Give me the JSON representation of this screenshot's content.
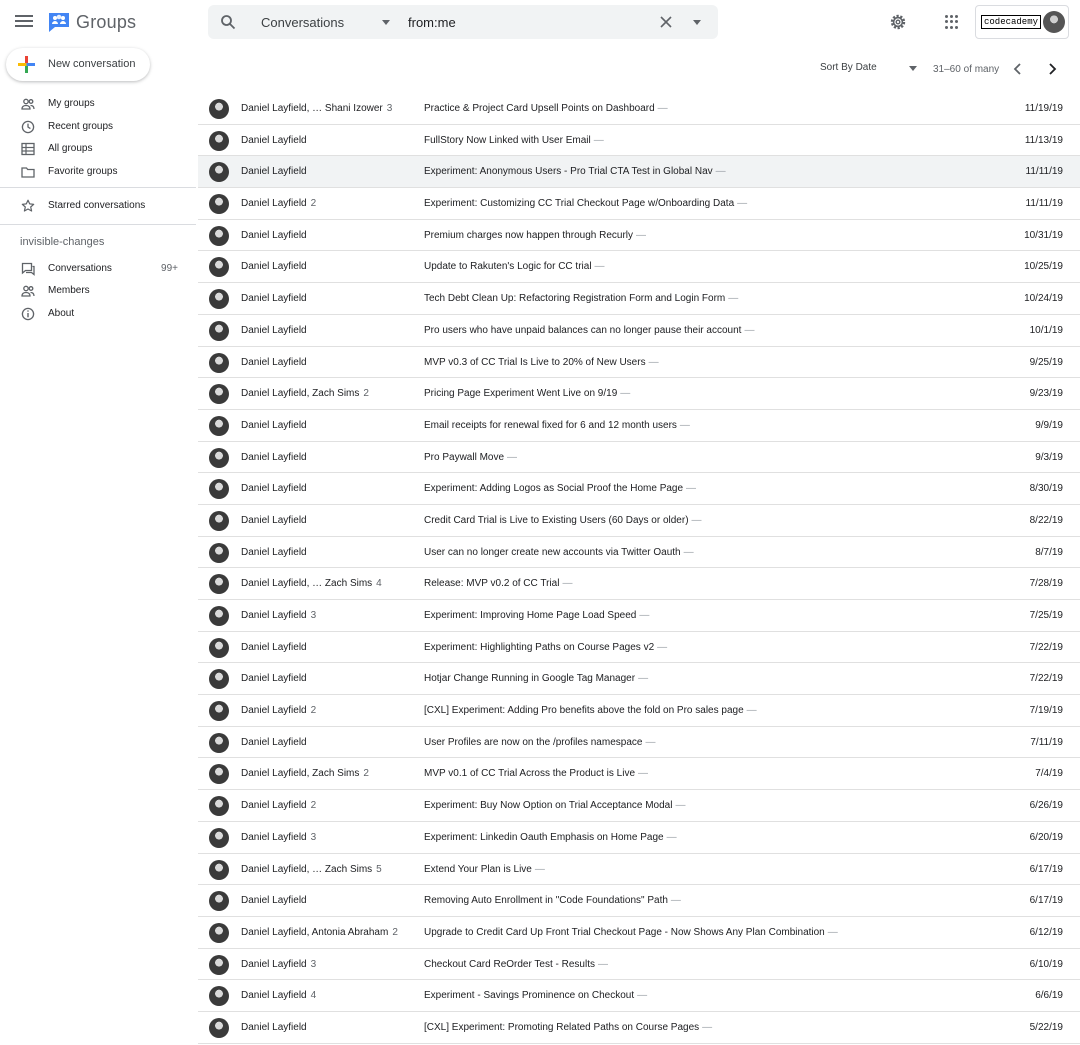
{
  "app": {
    "title": "Groups"
  },
  "search": {
    "scope": "Conversations",
    "query": "from:me"
  },
  "account": {
    "org_logo_text": "codecademy"
  },
  "sidebar": {
    "new_conversation": "New conversation",
    "items": [
      {
        "label": "My groups",
        "icon": "people-icon"
      },
      {
        "label": "Recent groups",
        "icon": "clock-icon"
      },
      {
        "label": "All groups",
        "icon": "table-icon"
      },
      {
        "label": "Favorite groups",
        "icon": "folder-icon"
      },
      {
        "label": "Starred conversations",
        "icon": "star-icon"
      }
    ],
    "section": "invisible-changes",
    "group_items": [
      {
        "label": "Conversations",
        "count": "99+",
        "icon": "chat-icon"
      },
      {
        "label": "Members",
        "icon": "people-icon"
      },
      {
        "label": "About",
        "icon": "info-icon"
      }
    ]
  },
  "toolbar": {
    "sort_label": "Sort By Date",
    "range": "31–60 of many"
  },
  "conversations": [
    {
      "author": "Daniel Layfield, … Shani Izower",
      "count": "3",
      "subject": "Practice & Project Card Upsell Points on Dashboard",
      "date": "11/19/19"
    },
    {
      "author": "Daniel Layfield",
      "count": "",
      "subject": "FullStory Now Linked with User Email",
      "date": "11/13/19"
    },
    {
      "author": "Daniel Layfield",
      "count": "",
      "subject": "Experiment: Anonymous Users - Pro Trial CTA Test in Global Nav",
      "date": "11/11/19"
    },
    {
      "author": "Daniel Layfield",
      "count": "2",
      "subject": "Experiment: Customizing CC Trial Checkout Page w/Onboarding Data",
      "date": "11/11/19"
    },
    {
      "author": "Daniel Layfield",
      "count": "",
      "subject": "Premium charges now happen through Recurly",
      "date": "10/31/19"
    },
    {
      "author": "Daniel Layfield",
      "count": "",
      "subject": "Update to Rakuten's Logic for CC trial",
      "date": "10/25/19"
    },
    {
      "author": "Daniel Layfield",
      "count": "",
      "subject": "Tech Debt Clean Up: Refactoring Registration Form and Login Form",
      "date": "10/24/19"
    },
    {
      "author": "Daniel Layfield",
      "count": "",
      "subject": "Pro users who have unpaid balances can no longer pause their account",
      "date": "10/1/19"
    },
    {
      "author": "Daniel Layfield",
      "count": "",
      "subject": "MVP v0.3 of CC Trial Is Live to 20% of New Users",
      "date": "9/25/19"
    },
    {
      "author": "Daniel Layfield, Zach Sims",
      "count": "2",
      "subject": "Pricing Page Experiment Went Live on 9/19",
      "date": "9/23/19"
    },
    {
      "author": "Daniel Layfield",
      "count": "",
      "subject": "Email receipts for renewal fixed for 6 and 12 month users",
      "date": "9/9/19"
    },
    {
      "author": "Daniel Layfield",
      "count": "",
      "subject": "Pro Paywall Move",
      "date": "9/3/19"
    },
    {
      "author": "Daniel Layfield",
      "count": "",
      "subject": "Experiment: Adding Logos as Social Proof the Home Page",
      "date": "8/30/19"
    },
    {
      "author": "Daniel Layfield",
      "count": "",
      "subject": "Credit Card Trial is Live to Existing Users (60 Days or older)",
      "date": "8/22/19"
    },
    {
      "author": "Daniel Layfield",
      "count": "",
      "subject": "User can no longer create new accounts via Twitter Oauth",
      "date": "8/7/19"
    },
    {
      "author": "Daniel Layfield, … Zach Sims",
      "count": "4",
      "subject": "Release: MVP v0.2 of CC Trial",
      "date": "7/28/19"
    },
    {
      "author": "Daniel Layfield",
      "count": "3",
      "subject": "Experiment: Improving Home Page Load Speed",
      "date": "7/25/19"
    },
    {
      "author": "Daniel Layfield",
      "count": "",
      "subject": "Experiment: Highlighting Paths on Course Pages v2",
      "date": "7/22/19"
    },
    {
      "author": "Daniel Layfield",
      "count": "",
      "subject": "Hotjar Change Running in Google Tag Manager",
      "date": "7/22/19"
    },
    {
      "author": "Daniel Layfield",
      "count": "2",
      "subject": "[CXL] Experiment: Adding Pro benefits above the fold on Pro sales page",
      "date": "7/19/19"
    },
    {
      "author": "Daniel Layfield",
      "count": "",
      "subject": "User Profiles are now on the /profiles namespace",
      "date": "7/11/19"
    },
    {
      "author": "Daniel Layfield, Zach Sims",
      "count": "2",
      "subject": "MVP v0.1 of CC Trial Across the Product is Live",
      "date": "7/4/19"
    },
    {
      "author": "Daniel Layfield",
      "count": "2",
      "subject": "Experiment: Buy Now Option on Trial Acceptance Modal",
      "date": "6/26/19"
    },
    {
      "author": "Daniel Layfield",
      "count": "3",
      "subject": "Experiment: Linkedin Oauth Emphasis on Home Page",
      "date": "6/20/19"
    },
    {
      "author": "Daniel Layfield, … Zach Sims",
      "count": "5",
      "subject": "Extend Your Plan is Live",
      "date": "6/17/19"
    },
    {
      "author": "Daniel Layfield",
      "count": "",
      "subject": "Removing Auto Enrollment in \"Code Foundations\" Path",
      "date": "6/17/19"
    },
    {
      "author": "Daniel Layfield, Antonia Abraham",
      "count": "2",
      "subject": "Upgrade to Credit Card Up Front Trial Checkout Page - Now Shows Any Plan Combination",
      "date": "6/12/19"
    },
    {
      "author": "Daniel Layfield",
      "count": "3",
      "subject": "Checkout Card ReOrder Test - Results",
      "date": "6/10/19"
    },
    {
      "author": "Daniel Layfield",
      "count": "4",
      "subject": "Experiment - Savings Prominence on Checkout",
      "date": "6/6/19"
    },
    {
      "author": "Daniel Layfield",
      "count": "",
      "subject": "[CXL] Experiment: Promoting Related Paths on Course Pages",
      "date": "5/22/19"
    }
  ]
}
